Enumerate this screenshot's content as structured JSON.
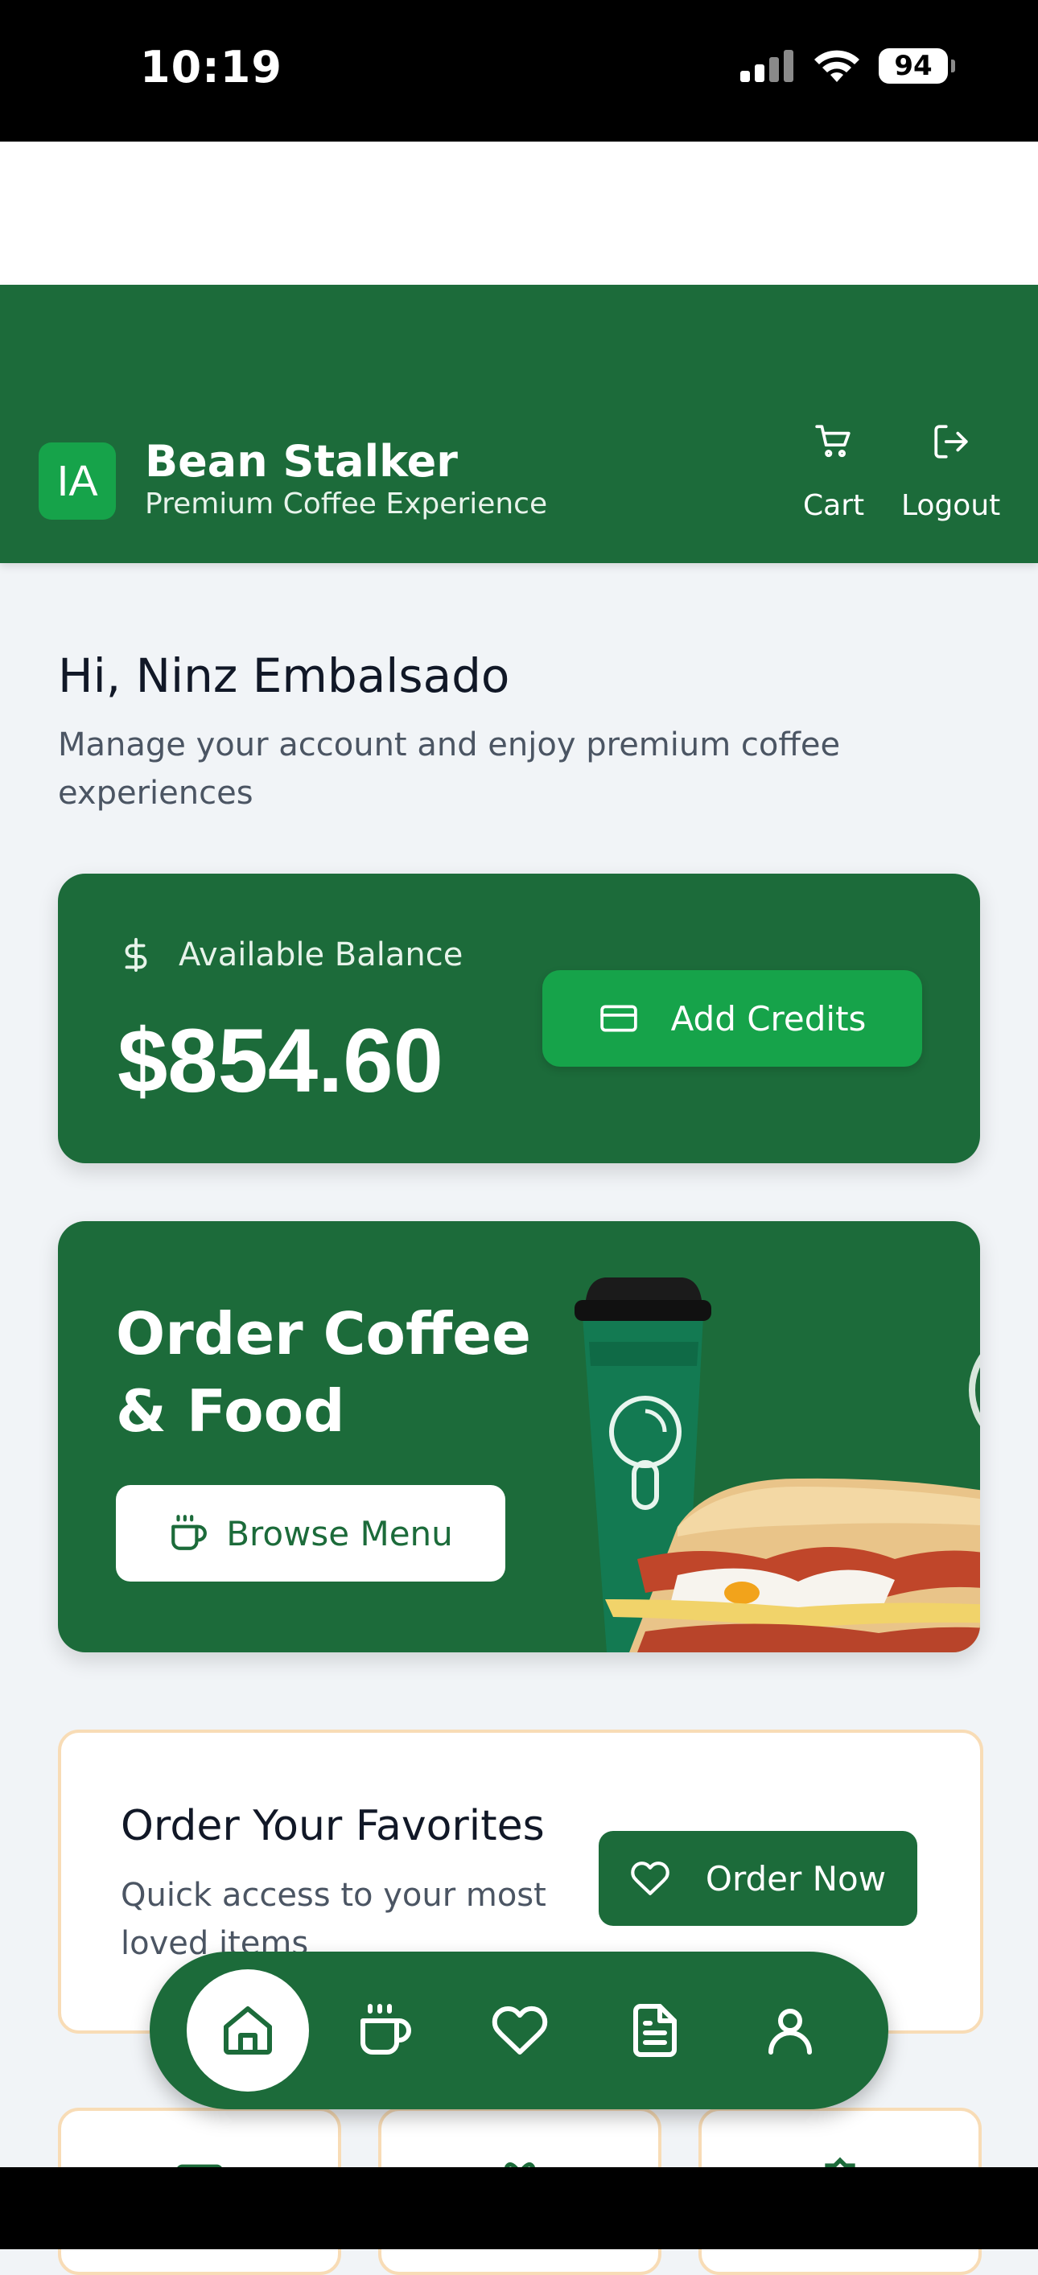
{
  "status_bar": {
    "time": "10:19",
    "battery": "94"
  },
  "header": {
    "logo_initials": "IA",
    "brand_name": "Bean Stalker",
    "brand_tagline": "Premium Coffee Experience",
    "cart_label": "Cart",
    "logout_label": "Logout"
  },
  "greeting": {
    "title": "Hi, Ninz Embalsado",
    "subtitle": "Manage your account and enjoy premium coffee experiences"
  },
  "balance": {
    "label": "Available Balance",
    "amount": "$854.60",
    "add_credits_label": "Add Credits"
  },
  "order_card": {
    "title_line1": "Order Coffee",
    "title_line2": "& Food",
    "browse_label": "Browse Menu"
  },
  "favorites": {
    "title": "Order Your Favorites",
    "description": "Quick access to your most loved items",
    "order_now_label": "Order Now"
  },
  "bottom_nav": {
    "items": [
      "home-icon",
      "coffee-icon",
      "heart-icon",
      "document-icon",
      "user-icon"
    ],
    "active": "home-icon"
  },
  "colors": {
    "primary": "#1c6b3a",
    "accent": "#16a34a",
    "card_border": "#f8dcb6"
  }
}
